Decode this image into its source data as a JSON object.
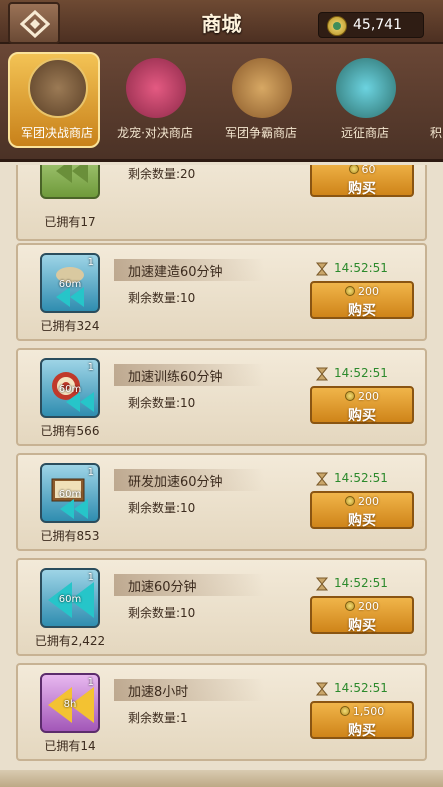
{
  "header": {
    "title": "商城",
    "currency_amount": "45,741"
  },
  "tabs": [
    {
      "label": "军团决战商店",
      "active": true
    },
    {
      "label": "龙宠·对决商店",
      "active": false
    },
    {
      "label": "军团争霸商店",
      "active": false
    },
    {
      "label": "远征商店",
      "active": false
    },
    {
      "label": "积",
      "active": false
    }
  ],
  "items": [
    {
      "name": "",
      "remain": "剩余数量:20",
      "owned": "已拥有17",
      "qty": "",
      "duration": "",
      "timer": "",
      "price": "60",
      "buy": "购买",
      "style": "green"
    },
    {
      "name": "加速建造60分钟",
      "remain": "剩余数量:10",
      "owned": "已拥有324",
      "qty": "1",
      "duration": "60m",
      "timer": "14:52:51",
      "price": "200",
      "buy": "购买",
      "style": "blue"
    },
    {
      "name": "加速训练60分钟",
      "remain": "剩余数量:10",
      "owned": "已拥有566",
      "qty": "1",
      "duration": "60m",
      "timer": "14:52:51",
      "price": "200",
      "buy": "购买",
      "style": "blue"
    },
    {
      "name": "研发加速60分钟",
      "remain": "剩余数量:10",
      "owned": "已拥有853",
      "qty": "1",
      "duration": "60m",
      "timer": "14:52:51",
      "price": "200",
      "buy": "购买",
      "style": "blue"
    },
    {
      "name": "加速60分钟",
      "remain": "剩余数量:10",
      "owned": "已拥有2,422",
      "qty": "1",
      "duration": "60m",
      "timer": "14:52:51",
      "price": "200",
      "buy": "购买",
      "style": "blue"
    },
    {
      "name": "加速8小时",
      "remain": "剩余数量:1",
      "owned": "已拥有14",
      "qty": "1",
      "duration": "8h",
      "timer": "14:52:51",
      "price": "1,500",
      "buy": "购买",
      "style": "purple"
    }
  ]
}
